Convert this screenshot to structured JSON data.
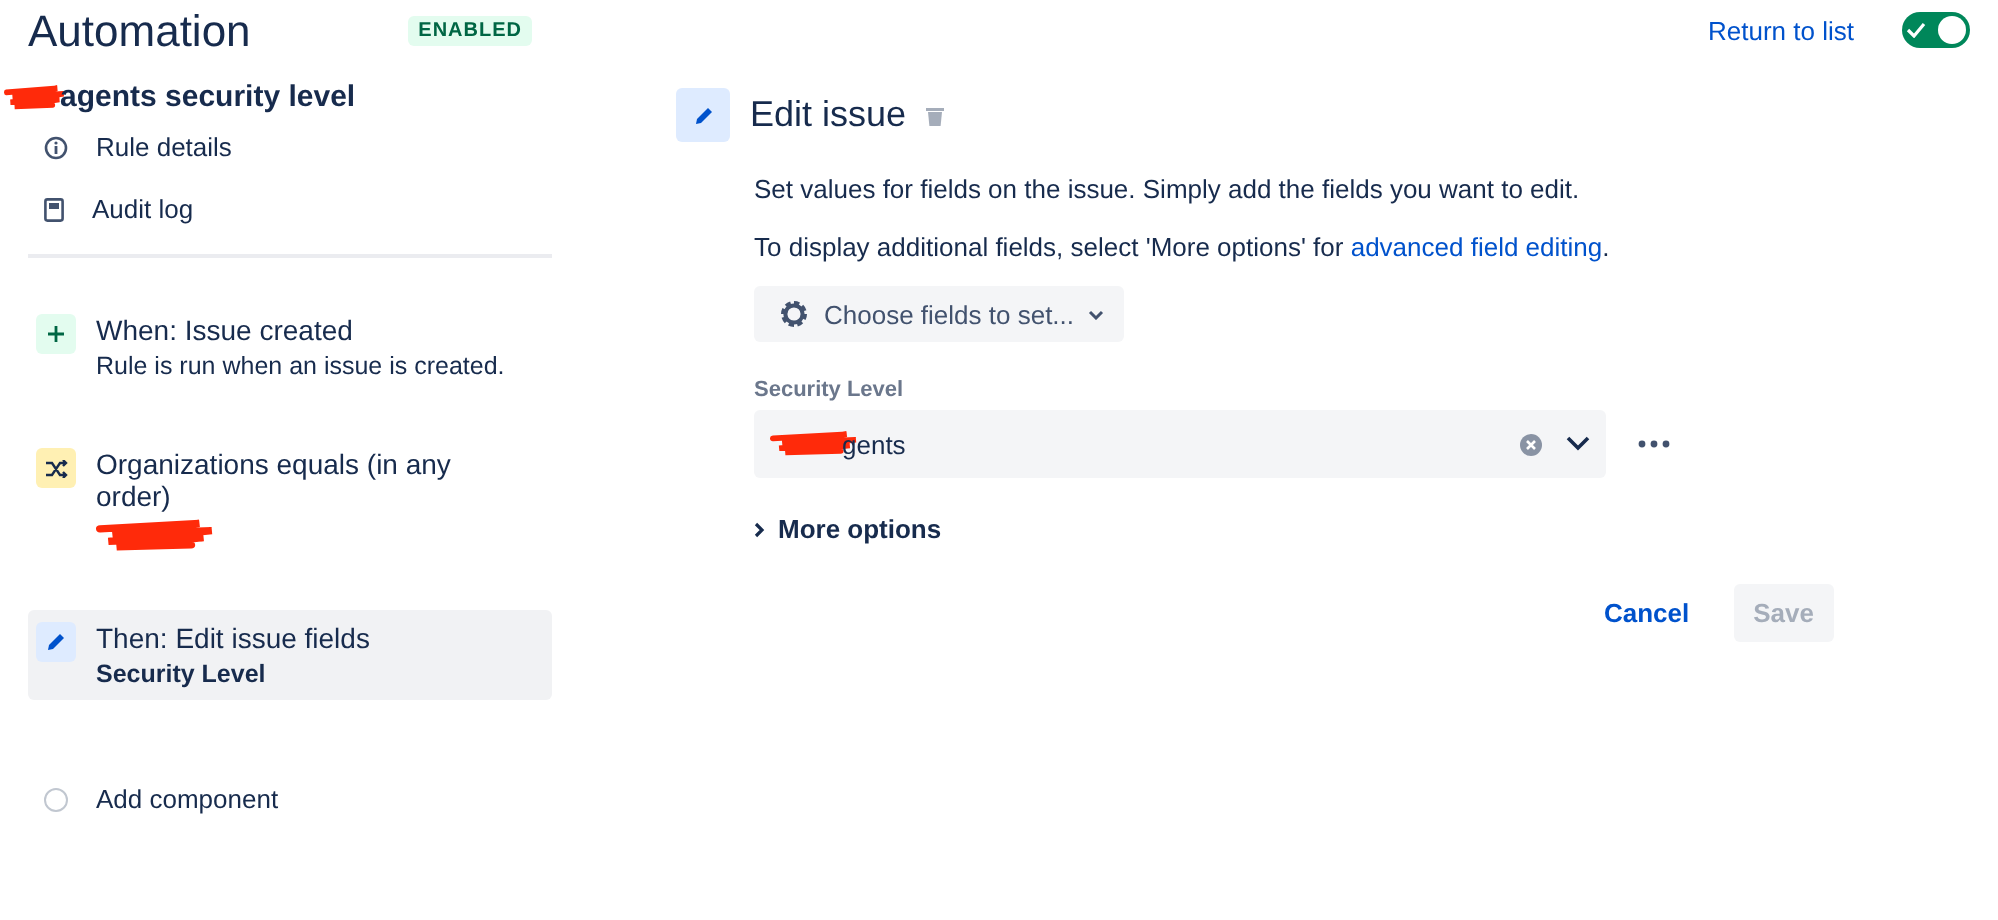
{
  "header": {
    "title": "Automation",
    "status_badge": "ENABLED",
    "return_link": "Return to list",
    "rule_toggle": {
      "on": true
    }
  },
  "sidebar": {
    "rule_name": {
      "text": "agents security level",
      "redacted": true
    },
    "links": [
      {
        "label": "Rule details",
        "kind": "info"
      },
      {
        "label": "Audit log",
        "kind": "log"
      }
    ],
    "components": [
      {
        "kind": "trigger",
        "title": "When: Issue created",
        "subtitle": "Rule is run when an issue is created.",
        "selected": false,
        "redacted": false
      },
      {
        "kind": "condition",
        "title": "Organizations equals (in any order)",
        "selected": false,
        "redacted": true
      },
      {
        "kind": "action",
        "title": "Then: Edit issue fields",
        "subtitle": "Security Level",
        "selected": true,
        "redacted": false
      }
    ],
    "add_component": "Add component"
  },
  "editor": {
    "title": "Edit issue",
    "description": "Set values for fields on the issue. Simply add the fields you want to edit.",
    "hint": "To display additional fields, select 'More options' for ",
    "hint_link": "advanced field editing",
    "hint_end": ".",
    "choose_button": "Choose fields to set...",
    "field": {
      "label": "Security Level",
      "value": "gents",
      "redacted": true
    },
    "more_options": "More options",
    "expanded": false,
    "cancel": "Cancel",
    "save": {
      "label": "Save",
      "disabled": true
    }
  }
}
